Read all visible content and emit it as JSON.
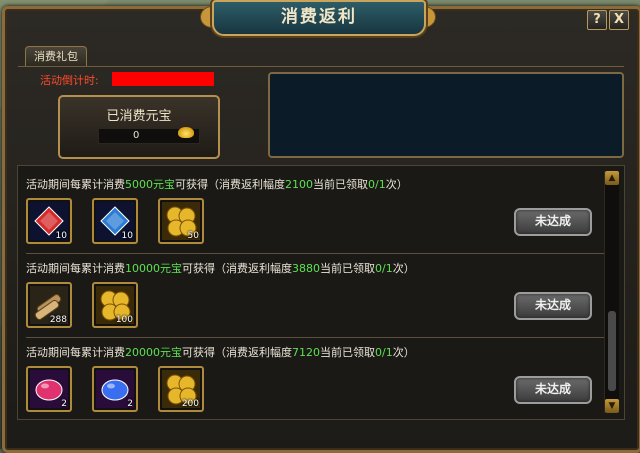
{
  "window": {
    "title": "消费返利"
  },
  "buttons": {
    "help": "?",
    "close": "X"
  },
  "tab": {
    "label": "消费礼包"
  },
  "countdown": {
    "label": "活动倒计时:",
    "value": ""
  },
  "spent": {
    "title": "已消费元宝",
    "value": "0"
  },
  "rows": [
    {
      "prefix": "活动期间每累计消费",
      "amount": "5000元宝",
      "mid": "可获得（消费返利幅度",
      "rate": "2100",
      "suffix": "当前已领取",
      "claimed": "0/1",
      "end": "次）",
      "status": "未达成",
      "items": [
        {
          "icon": "red-gem-icon",
          "qty": "10",
          "color": "#d32a2a"
        },
        {
          "icon": "blue-gem-icon",
          "qty": "10",
          "color": "#2a7bd3"
        },
        {
          "icon": "gold-coins-icon",
          "qty": "50",
          "color": "#e6b72a"
        }
      ]
    },
    {
      "prefix": "活动期间每累计消费",
      "amount": "10000元宝",
      "mid": "可获得（消费返利幅度",
      "rate": "3880",
      "suffix": "当前已领取",
      "claimed": "0/1",
      "end": "次）",
      "status": "未达成",
      "items": [
        {
          "icon": "scroll-bundle-icon",
          "qty": "288",
          "color": "#b8925a"
        },
        {
          "icon": "gold-coins-icon",
          "qty": "100",
          "color": "#e6b72a"
        }
      ]
    },
    {
      "prefix": "活动期间每累计消费",
      "amount": "20000元宝",
      "mid": "可获得（消费返利幅度",
      "rate": "7120",
      "suffix": "当前已领取",
      "claimed": "0/1",
      "end": "次）",
      "status": "未达成",
      "items": [
        {
          "icon": "red-orb-icon",
          "qty": "2",
          "color": "#e0326e"
        },
        {
          "icon": "blue-orb-icon",
          "qty": "2",
          "color": "#3a6ef0"
        },
        {
          "icon": "gold-coins-icon",
          "qty": "200",
          "color": "#e6b72a"
        }
      ]
    }
  ],
  "colors": {
    "accent_green": "#5ee053",
    "countdown_red": "#ff4a2a",
    "frame_gold": "#b08a3c"
  }
}
